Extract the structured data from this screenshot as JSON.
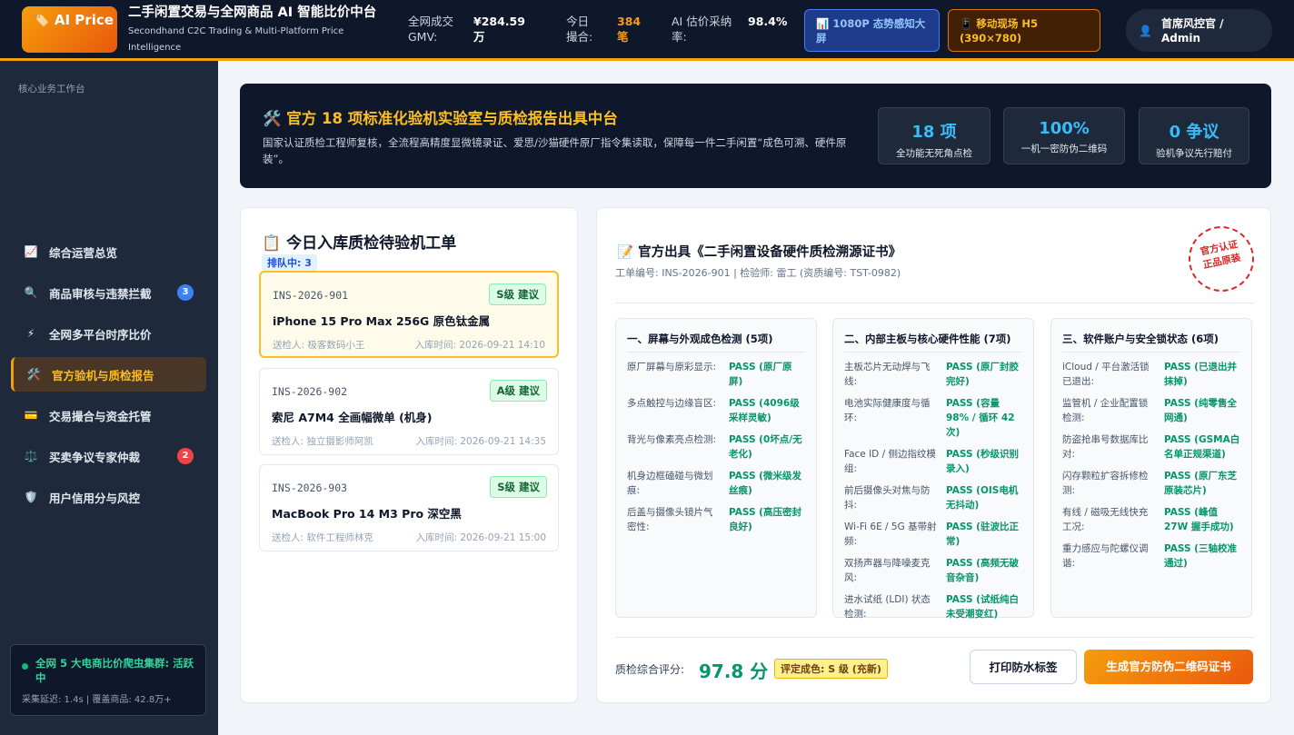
{
  "header": {
    "logo": "🏷️ AI Price",
    "title": "二手闲置交易与全网商品 AI 智能比价中台",
    "subtitle": "Secondhand C2C Trading & Multi-Platform Price Intelligence",
    "stats": [
      {
        "label": "全网成交 GMV:",
        "value": "¥284.59 万"
      },
      {
        "label": "今日撮合:",
        "value": "384 笔"
      },
      {
        "label": "AI 估价采纳率:",
        "value": "98.4%"
      }
    ],
    "btn_dashboard": "📊 1080P 态势感知大屏",
    "btn_mobile": "📱 移动现场 H5 (390×780)",
    "admin": "首席风控官 / Admin",
    "admin_icon": "user-icon"
  },
  "sidebar": {
    "section": "核心业务工作台",
    "items": [
      {
        "icon": "📈",
        "label": "综合运营总览",
        "badge": ""
      },
      {
        "icon": "🔍",
        "label": "商品审核与违禁拦截",
        "badge": "3"
      },
      {
        "icon": "⚡",
        "label": "全网多平台时序比价",
        "badge": ""
      },
      {
        "icon": "🛠️",
        "label": "官方验机与质检报告",
        "badge": ""
      },
      {
        "icon": "💳",
        "label": "交易撮合与资金托管",
        "badge": ""
      },
      {
        "icon": "⚖️",
        "label": "买卖争议专家仲裁",
        "badge": "2"
      },
      {
        "icon": "🛡️",
        "label": "用户信用分与风控",
        "badge": ""
      }
    ],
    "crawler_title": "全网 5 大电商比价爬虫集群: 活跃中",
    "crawler_stats": "采集延迟: 1.4s | 覆盖商品: 42.8万+"
  },
  "banner": {
    "title": "🛠️ 官方 18 项标准化验机实验室与质检报告出具中台",
    "desc": "国家认证质检工程师复核，全流程高精度显微镜录证、爱思/沙猫硬件原厂指令集读取，保障每一件二手闲置“成色可溯、硬件原装”。",
    "kpis": [
      {
        "value": "18 项",
        "label": "全功能无死角点检"
      },
      {
        "value": "100%",
        "label": "一机一密防伪二维码"
      },
      {
        "value": "0 争议",
        "label": "验机争议先行赔付"
      }
    ]
  },
  "orders": {
    "title": "📋 今日入库质检待验机工单",
    "queue": "排队中: 3",
    "items": [
      {
        "id": "INS-2026-901",
        "grade": "S级 建议",
        "name": "iPhone 15 Pro Max 256G 原色钛金属",
        "sender": "送检人: 极客数码小王",
        "time": "入库时间: 2026-09-21 14:10"
      },
      {
        "id": "INS-2026-902",
        "grade": "A级 建议",
        "name": "索尼 A7M4 全画幅微单 (机身)",
        "sender": "送检人: 独立摄影师阿凯",
        "time": "入库时间: 2026-09-21 14:35"
      },
      {
        "id": "INS-2026-903",
        "grade": "S级 建议",
        "name": "MacBook Pro 14 M3 Pro 深空黑",
        "sender": "送检人: 软件工程师林克",
        "time": "入库时间: 2026-09-21 15:00"
      }
    ]
  },
  "cert": {
    "title": "📝 官方出具《二手闲置设备硬件质检溯源证书》",
    "meta": "工单编号: INS-2026-901 | 检验师: 雷工 (资质编号: TST-0982)",
    "stamp": "官方认证 正品原装",
    "sections": [
      {
        "title": "一、屏幕与外观成色检测 (5项)",
        "rows": [
          {
            "k": "原厂屏幕与原彩显示:",
            "v": "PASS (原厂原屏)"
          },
          {
            "k": "多点触控与边缘盲区:",
            "v": "PASS (4096级采样灵敏)"
          },
          {
            "k": "背光与像素亮点检测:",
            "v": "PASS (0坏点/无老化)"
          },
          {
            "k": "机身边框磕碰与微划痕:",
            "v": "PASS (微米级发丝痕)"
          },
          {
            "k": "后盖与摄像头镜片气密性:",
            "v": "PASS (高压密封良好)"
          }
        ]
      },
      {
        "title": "二、内部主板与核心硬件性能 (7项)",
        "rows": [
          {
            "k": "主板芯片无动焊与飞线:",
            "v": "PASS (原厂封胶完好)"
          },
          {
            "k": "电池实际健康度与循环:",
            "v": "PASS (容量 98% / 循环 42次)"
          },
          {
            "k": "Face ID / 侧边指纹模组:",
            "v": "PASS (秒级识别录入)"
          },
          {
            "k": "前后摄像头对焦与防抖:",
            "v": "PASS (OIS电机无抖动)"
          },
          {
            "k": "Wi-Fi 6E / 5G 基带射频:",
            "v": "PASS (驻波比正常)"
          },
          {
            "k": "双扬声器与降噪麦克风:",
            "v": "PASS (高频无破音杂音)"
          },
          {
            "k": "进水试纸 (LDI) 状态检测:",
            "v": "PASS (试纸纯白未受潮变红)"
          }
        ]
      },
      {
        "title": "三、软件账户与安全锁状态 (6项)",
        "rows": [
          {
            "k": "iCloud / 平台激活锁已退出:",
            "v": "PASS (已退出并抹掉)"
          },
          {
            "k": "监管机 / 企业配置锁检测:",
            "v": "PASS (纯零售全网通)"
          },
          {
            "k": "防盗抢串号数据库比对:",
            "v": "PASS (GSMA白名单正规渠道)"
          },
          {
            "k": "闪存颗粒扩容拆修检测:",
            "v": "PASS (原厂东芝原装芯片)"
          },
          {
            "k": "有线 / 磁吸无线快充工况:",
            "v": "PASS (峰值 27W 握手成功)"
          },
          {
            "k": "重力感应与陀螺仪调谐:",
            "v": "PASS (三轴校准通过)"
          }
        ]
      }
    ],
    "score_label": "质检综合评分:",
    "score": "97.8 分",
    "grade": "评定成色: S 级 (充新)",
    "print_btn": "打印防水标签",
    "gen_btn": "生成官方防伪二维码证书"
  }
}
